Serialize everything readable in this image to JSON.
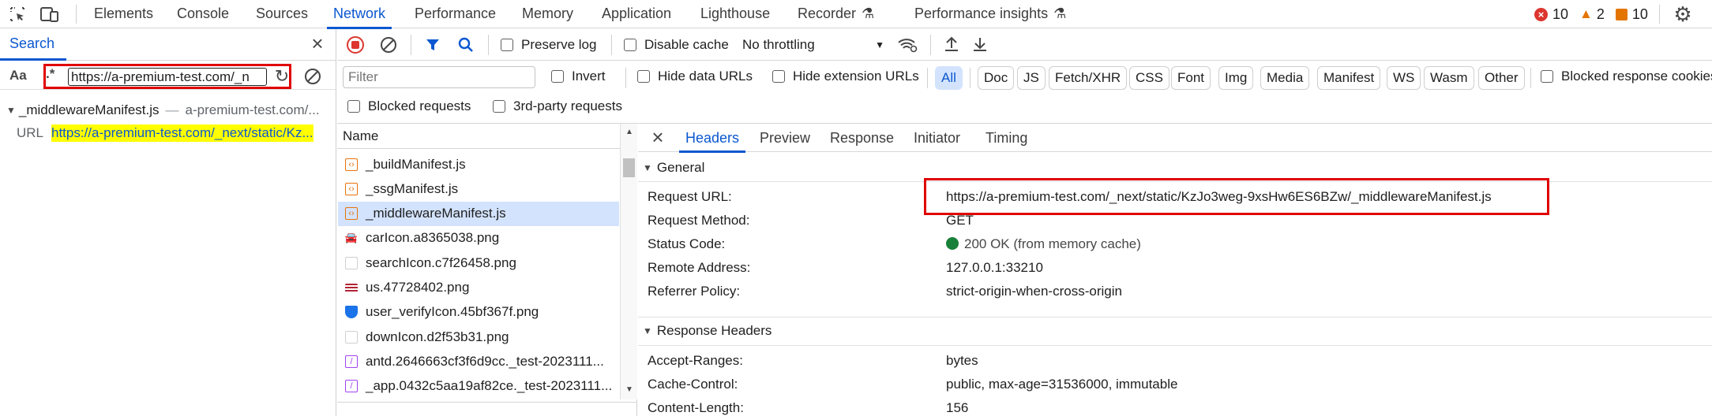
{
  "top_tabs": [
    "Elements",
    "Console",
    "Sources",
    "Network",
    "Performance",
    "Memory",
    "Application",
    "Lighthouse",
    "Recorder",
    "Performance insights"
  ],
  "status": {
    "errors": "10",
    "warnings": "2",
    "issues": "10"
  },
  "search": {
    "title": "Search",
    "case_label": "Aa",
    "regex_label": ".*",
    "query": "https://a-premium-test.com/_n",
    "result_file": "_middlewareManifest.js",
    "result_host": "a-premium-test.com/...",
    "result_kind": "URL",
    "result_text": "https://a-premium-test.com/_next/static/Kz..."
  },
  "toolbar": {
    "preserve_log": "Preserve log",
    "disable_cache": "Disable cache",
    "throttling": "No throttling",
    "filter_placeholder": "Filter",
    "invert": "Invert",
    "hide_data_urls": "Hide data URLs",
    "hide_ext_urls": "Hide extension URLs",
    "blocked_response_cookies": "Blocked response cookies",
    "blocked_requests": "Blocked requests",
    "third_party": "3rd-party requests"
  },
  "type_filters": [
    "All",
    "Doc",
    "JS",
    "Fetch/XHR",
    "CSS",
    "Font",
    "Img",
    "Media",
    "Manifest",
    "WS",
    "Wasm",
    "Other"
  ],
  "requests": {
    "column": "Name",
    "items": [
      {
        "name": "_buildManifest.js",
        "icon": "js-file-icon",
        "color": "#e8710a"
      },
      {
        "name": "_ssgManifest.js",
        "icon": "js-file-icon",
        "color": "#e8710a"
      },
      {
        "name": "_middlewareManifest.js",
        "icon": "js-file-icon",
        "color": "#e8710a"
      },
      {
        "name": "carIcon.a8365038.png",
        "icon": "car-image-icon",
        "color": "#1f1f1f"
      },
      {
        "name": "searchIcon.c7f26458.png",
        "icon": "blank-image-icon",
        "color": "#d0d0d0"
      },
      {
        "name": "us.47728402.png",
        "icon": "flag-image-icon",
        "color": "#b22234"
      },
      {
        "name": "user_verifyIcon.45bf367f.png",
        "icon": "shield-image-icon",
        "color": "#1a73e8"
      },
      {
        "name": "downIcon.d2f53b31.png",
        "icon": "blank-image-icon",
        "color": "#d0d0d0"
      },
      {
        "name": "antd.2646663cf3f6d9cc._test-2023111...",
        "icon": "css-file-icon",
        "color": "#a142f4"
      },
      {
        "name": "_app.0432c5aa19af82ce._test-2023111...",
        "icon": "css-file-icon",
        "color": "#a142f4"
      }
    ]
  },
  "detail_tabs": [
    "Headers",
    "Preview",
    "Response",
    "Initiator",
    "Timing"
  ],
  "general": {
    "title": "General",
    "rows": [
      {
        "k": "Request URL:",
        "v": "https://a-premium-test.com/_next/static/KzJo3weg-9xsHw6ES6BZw/_middlewareManifest.js"
      },
      {
        "k": "Request Method:",
        "v": "GET"
      },
      {
        "k": "Status Code:",
        "v": "200 OK (from memory cache)"
      },
      {
        "k": "Remote Address:",
        "v": "127.0.0.1:33210"
      },
      {
        "k": "Referrer Policy:",
        "v": "strict-origin-when-cross-origin"
      }
    ]
  },
  "response_headers": {
    "title": "Response Headers",
    "rows": [
      {
        "k": "Accept-Ranges:",
        "v": "bytes"
      },
      {
        "k": "Cache-Control:",
        "v": "public, max-age=31536000, immutable"
      },
      {
        "k": "Content-Length:",
        "v": "156"
      }
    ]
  },
  "colors": {
    "accent": "#0b57d0",
    "highlight": "#ffff00",
    "red_box": "#e00000",
    "ok": "#188038",
    "selected_row": "#d3e3fd"
  }
}
